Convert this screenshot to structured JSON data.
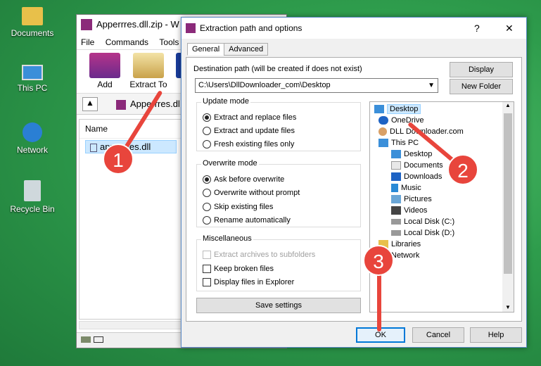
{
  "desktop": {
    "icons": [
      {
        "label": "Documents"
      },
      {
        "label": "This PC"
      },
      {
        "label": "Network"
      },
      {
        "label": "Recycle Bin"
      }
    ]
  },
  "winrar": {
    "title": "Apperrres.dll.zip - W",
    "menu": [
      "File",
      "Commands",
      "Tools"
    ],
    "tools": {
      "add": "Add",
      "extract_to": "Extract To"
    },
    "address": "Apperrres.dl",
    "column_name": "Name",
    "file": "apperrres.dll"
  },
  "dialog": {
    "title": "Extraction path and options",
    "help": "?",
    "close": "✕",
    "tabs": {
      "general": "General",
      "advanced": "Advanced"
    },
    "dest_label": "Destination path (will be created if does not exist)",
    "dest_value": "C:\\Users\\DllDownloader_com\\Desktop",
    "display": "Display",
    "new_folder": "New Folder",
    "update_mode": {
      "label": "Update mode",
      "options": [
        "Extract and replace files",
        "Extract and update files",
        "Fresh existing files only"
      ]
    },
    "overwrite_mode": {
      "label": "Overwrite mode",
      "options": [
        "Ask before overwrite",
        "Overwrite without prompt",
        "Skip existing files",
        "Rename automatically"
      ]
    },
    "misc": {
      "label": "Miscellaneous",
      "options": [
        "Extract archives to subfolders",
        "Keep broken files",
        "Display files in Explorer"
      ]
    },
    "save_settings": "Save settings",
    "ok": "OK",
    "cancel": "Cancel",
    "help_btn": "Help",
    "tree": [
      "Desktop",
      "OneDrive",
      "DLL Downloader.com",
      "This PC",
      "Desktop",
      "Documents",
      "Downloads",
      "Music",
      "Pictures",
      "Videos",
      "Local Disk (C:)",
      "Local Disk (D:)",
      "Libraries",
      "Network"
    ]
  },
  "annotations": {
    "one": "1",
    "two": "2",
    "three": "3"
  },
  "colors": {
    "accent": "#0078d7",
    "annotation": "#e8453c"
  }
}
